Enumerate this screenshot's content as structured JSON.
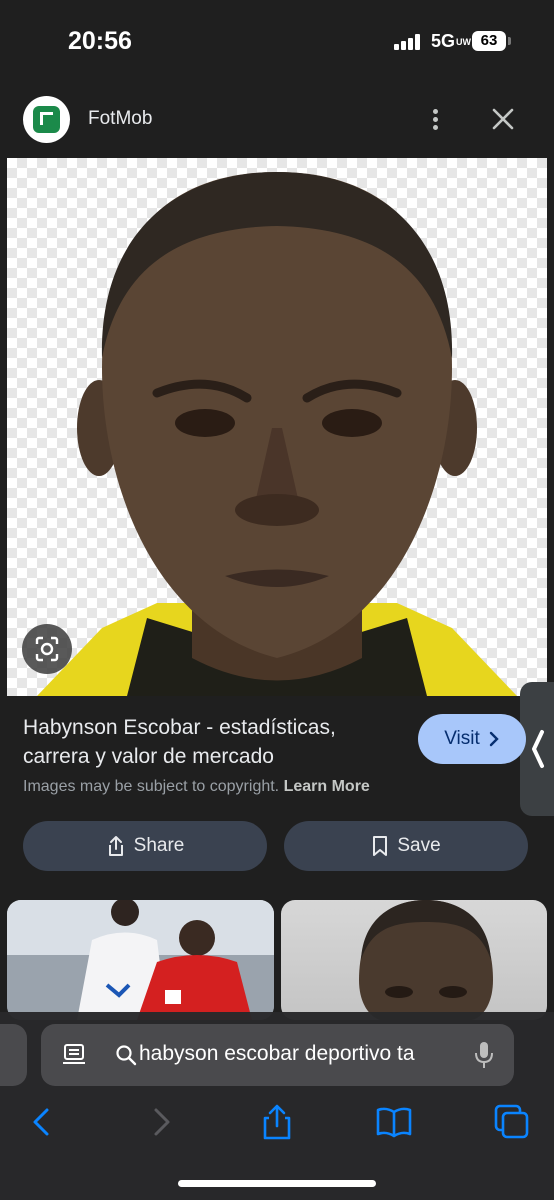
{
  "status_bar": {
    "time": "20:56",
    "network": "5G",
    "network_sub": "UW",
    "battery": "63"
  },
  "source": {
    "name": "FotMob",
    "logo_color": "#1b8a4a"
  },
  "result": {
    "title": "Habynson Escobar - estadísticas, carrera y valor de mercado",
    "visit_label": "Visit",
    "copyright_text": "Images may be subject to copyright.",
    "learn_more": "Learn More"
  },
  "actions": {
    "share_label": "Share",
    "save_label": "Save"
  },
  "browser": {
    "url_text": "habyson escobar deportivo ta"
  },
  "colors": {
    "background": "#1f1f1f",
    "visit_button": "#a8c7fa",
    "action_button": "#3a4250",
    "browser_accent": "#0a84ff"
  },
  "icons": [
    "signal-icon",
    "more-vert-icon",
    "close-icon",
    "lens-icon",
    "chevron-left-icon",
    "chevron-right-icon",
    "share-icon",
    "bookmark-icon",
    "reader-icon",
    "search-icon",
    "mic-icon",
    "back-icon",
    "forward-icon",
    "bookmarks-icon",
    "tabs-icon"
  ]
}
